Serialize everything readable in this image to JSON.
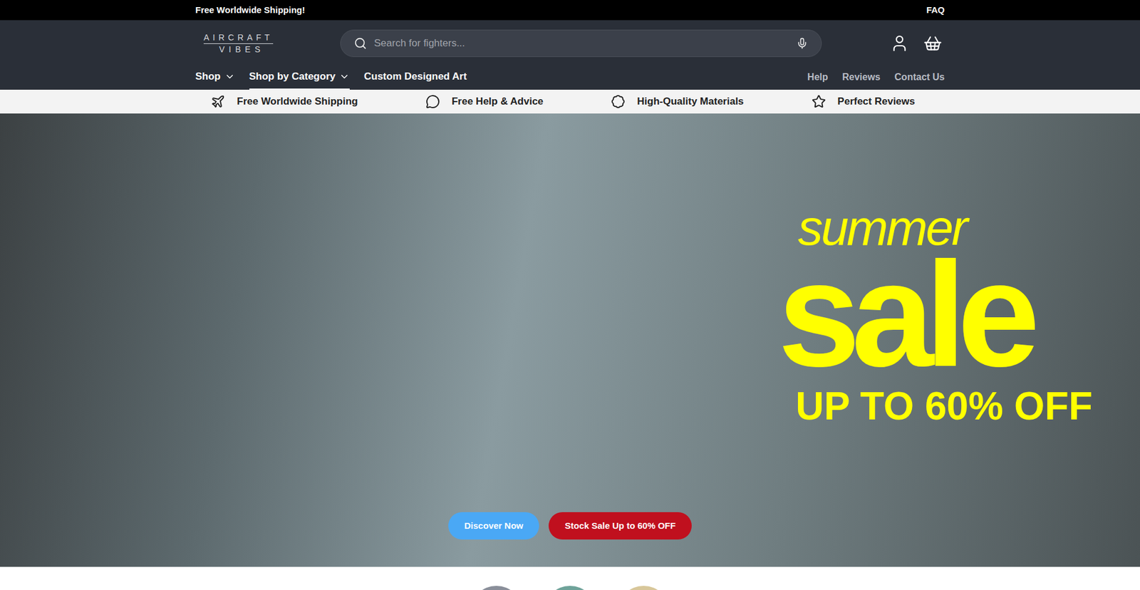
{
  "topbar": {
    "announcement": "Free Worldwide Shipping!",
    "link": "FAQ"
  },
  "header": {
    "logo": [
      "AIRCRAFT",
      "VIBES"
    ],
    "search": {
      "placeholder": "Search for fighters..."
    }
  },
  "nav": {
    "left": [
      {
        "label": "Shop",
        "dropdown": true,
        "selected": false
      },
      {
        "label": "Shop by Category",
        "dropdown": true,
        "selected": true
      },
      {
        "label": "Custom Designed Art",
        "dropdown": false,
        "selected": false
      }
    ],
    "right": [
      "Help",
      "Reviews",
      "Contact Us"
    ]
  },
  "features": [
    {
      "label": "Free Worldwide Shipping",
      "kind": "plane"
    },
    {
      "label": "Free Help & Advice",
      "kind": "chat"
    },
    {
      "label": "High-Quality Materials",
      "kind": "badge"
    },
    {
      "label": "Perfect Reviews",
      "kind": "star"
    }
  ],
  "hero": {
    "headline": {
      "small": "summer",
      "big": "sale",
      "offer": "UP TO 60% OFF"
    },
    "buttons": [
      {
        "label": "Discover Now",
        "color": "#4aa8f5"
      },
      {
        "label": "Stock Sale Up to 60% OFF",
        "color": "#c0101e"
      }
    ]
  }
}
